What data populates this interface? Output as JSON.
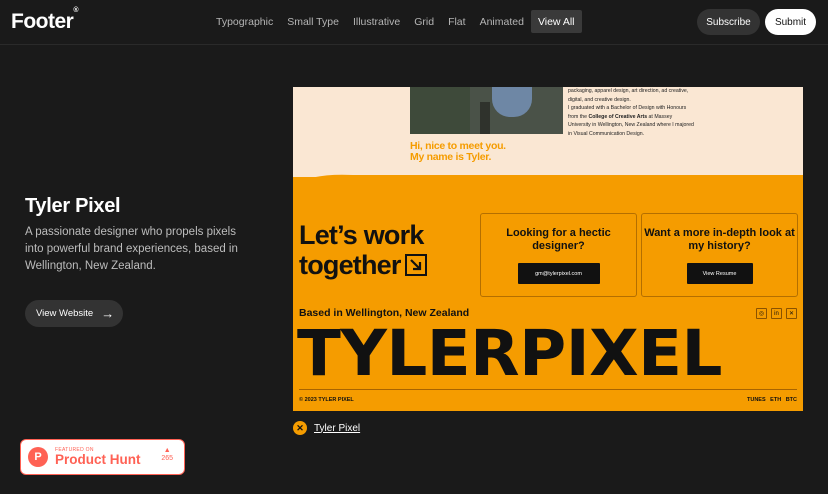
{
  "nav": {
    "logo": "Footer",
    "logo_mark": "®",
    "filters": [
      "Typographic",
      "Small Type",
      "Illustrative",
      "Grid",
      "Flat",
      "Animated",
      "View All"
    ],
    "active_filter": "View All",
    "subscribe_label": "Subscribe",
    "submit_label": "Submit"
  },
  "site": {
    "title": "Tyler Pixel",
    "description": "A passionate designer who propels pixels into powerful brand experiences, based in Wellington, New Zealand.",
    "view_website_label": "View Website"
  },
  "preview": {
    "bio_1": "packaging, apparel design, art direction, ad creative, digital, and creative design.",
    "bio_2a": "I graduated with a Bachelor of Design with Honours from the ",
    "bio_2b": "College of Creative Arts",
    "bio_2c": " at Massey University in Wellington, New Zealand where I majored in Visual Communication Design.",
    "hi_line1": "Hi, nice to meet you.",
    "hi_line2": "My name is Tyler.",
    "lets_line1": "Let’s work",
    "lets_line2": "together",
    "card1_title": "Looking for a hectic designer?",
    "card1_button": "gm@tylerpixel.com",
    "card2_title": "Want a more in-depth look at my history?",
    "card2_button": "View Resume",
    "based": "Based in Wellington, New Zealand",
    "big_wordmark": "TYLERPIXEL",
    "copyright": "© 2023 TYLER PIXEL",
    "footer_links": "TUNES ETH BTC",
    "social_icons": [
      "instagram-icon",
      "linkedin-icon",
      "x-icon"
    ]
  },
  "caption": {
    "link": "Tyler Pixel"
  },
  "product_hunt": {
    "small": "FEATURED ON",
    "big": "Product Hunt",
    "votes": "265",
    "logo_letter": "P"
  },
  "colors": {
    "accent_orange": "#f59c00",
    "cream": "#fae7d3",
    "product_hunt": "#ff6154"
  }
}
